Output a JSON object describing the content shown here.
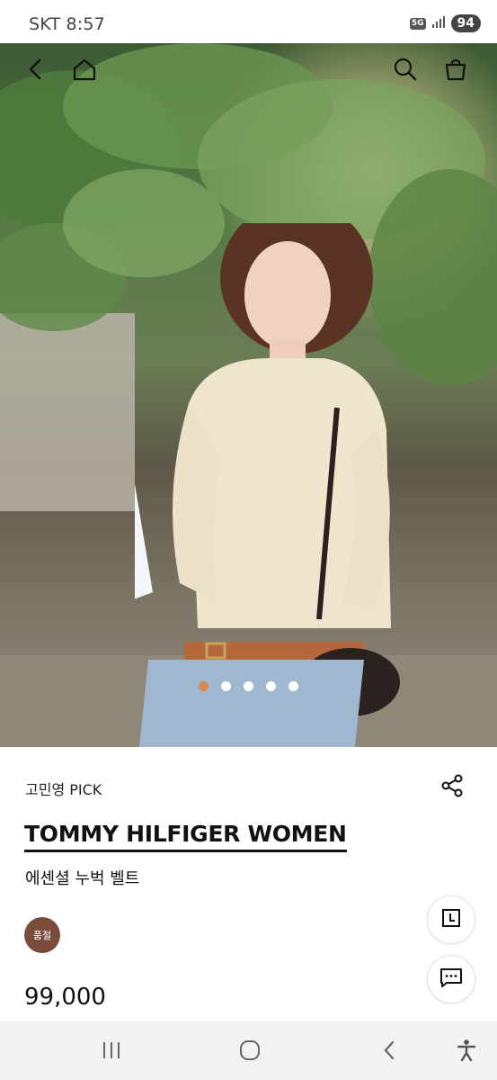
{
  "status_bar": {
    "carrier_time": "SKT 8:57",
    "network": "5G",
    "battery": "94"
  },
  "hero": {
    "carousel_total": 5,
    "carousel_active": 1,
    "accent_color": "#d9894b"
  },
  "icons": {
    "back": "back-icon",
    "home": "home-icon",
    "search": "search-icon",
    "cart": "cart-icon",
    "share": "share-icon",
    "recent": "recent-icon",
    "chat": "chat-icon"
  },
  "product": {
    "pick_label": "고민영 PICK",
    "brand": "TOMMY HILFIGER WOMEN",
    "name": "에센셜 누벅 벨트",
    "badge": "품절",
    "price": "99,000"
  },
  "system_nav": {
    "recents": "recents-icon",
    "home": "home-circle-icon",
    "back": "back-chevron-icon",
    "accessibility": "accessibility-icon"
  }
}
